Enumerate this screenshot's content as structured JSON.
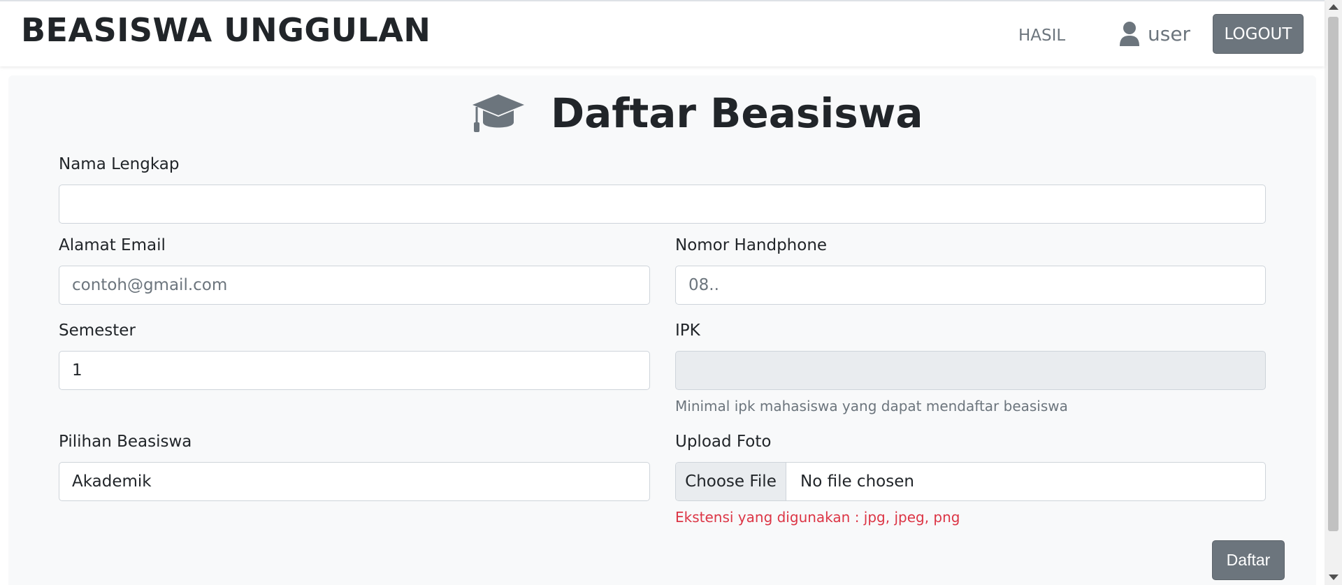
{
  "navbar": {
    "brand": "BEASISWA UNGGULAN",
    "hasil_link": "HASIL",
    "user_icon": "user-icon",
    "username": "user",
    "logout_label": "LOGOUT"
  },
  "form": {
    "title_icon": "graduation-cap-icon",
    "title": "Daftar Beasiswa",
    "nama": {
      "label": "Nama Lengkap",
      "value": ""
    },
    "email": {
      "label": "Alamat Email",
      "placeholder": "contoh@gmail.com"
    },
    "phone": {
      "label": "Nomor Handphone",
      "placeholder": "08.."
    },
    "semester": {
      "label": "Semester",
      "value": "1"
    },
    "ipk": {
      "label": "IPK",
      "value": "",
      "help": "Minimal ipk mahasiswa yang dapat mendaftar beasiswa"
    },
    "pilihan": {
      "label": "Pilihan Beasiswa",
      "value": "Akademik"
    },
    "upload": {
      "label": "Upload Foto",
      "button": "Choose File",
      "status": "No file chosen",
      "help": "Ekstensi yang digunakan : jpg, jpeg, png"
    },
    "submit_label": "Daftar"
  },
  "colors": {
    "secondary": "#6c757d",
    "danger": "#dc3545",
    "card_bg": "#f8f9fa",
    "disabled_bg": "#e9ecef"
  }
}
